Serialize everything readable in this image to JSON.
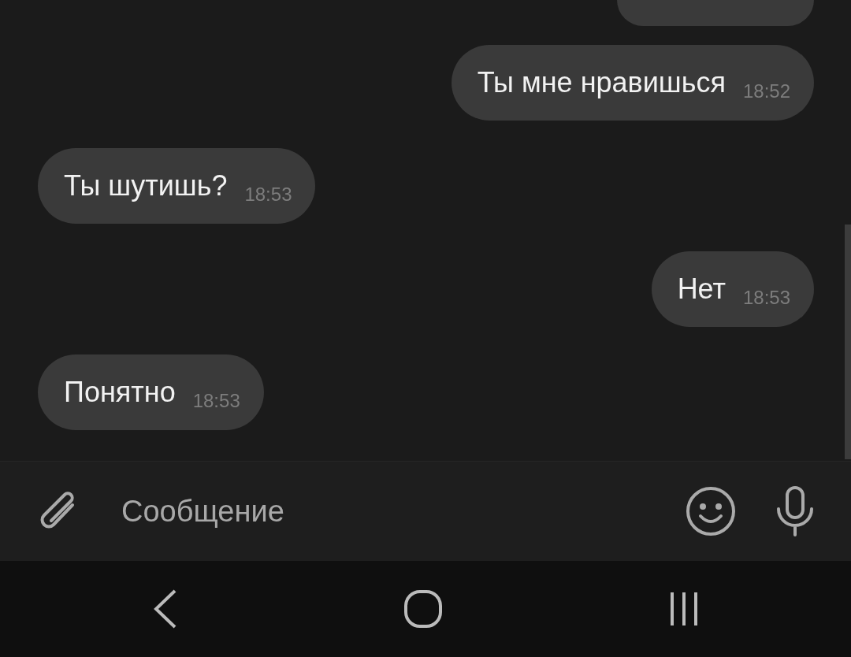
{
  "messages": [
    {
      "kind": "cutoff"
    },
    {
      "kind": "outgoing",
      "text": "Ты мне нравишься",
      "time": "18:52"
    },
    {
      "kind": "incoming",
      "text": "Ты шутишь?",
      "time": "18:53"
    },
    {
      "kind": "outgoing",
      "text": "Нет",
      "time": "18:53"
    },
    {
      "kind": "incoming",
      "text": "Понятно",
      "time": "18:53"
    }
  ],
  "composer": {
    "placeholder": "Сообщение"
  }
}
